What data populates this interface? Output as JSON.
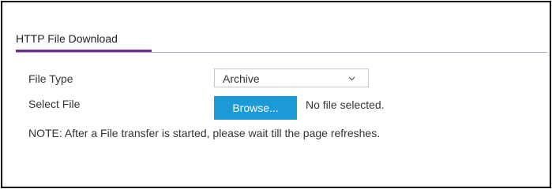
{
  "panel": {
    "title": "HTTP File Download"
  },
  "form": {
    "file_type_label": "File Type",
    "file_type_value": "Archive",
    "select_file_label": "Select File",
    "browse_label": "Browse...",
    "file_status": "No file selected."
  },
  "note": "NOTE: After a File transfer is started, please wait till the page refreshes.",
  "colors": {
    "accent_purple": "#6b2d8f",
    "button_blue": "#1b9ad6"
  },
  "icons": {
    "select_arrow": "chevron-down-icon"
  }
}
